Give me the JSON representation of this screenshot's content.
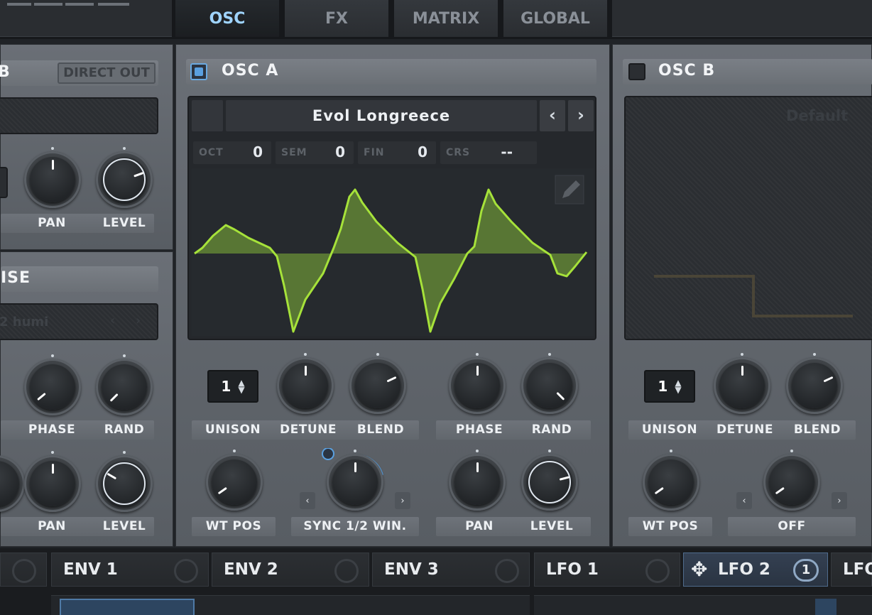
{
  "top_tabs": [
    {
      "label": "OSC",
      "active": true
    },
    {
      "label": "FX",
      "active": false
    },
    {
      "label": "MATRIX",
      "active": false
    },
    {
      "label": "GLOBAL",
      "active": false
    }
  ],
  "left_panel": {
    "header_partial": "B",
    "direct_out_label": "DIRECT OUT",
    "knob_row1_labels": [
      "PAN",
      "LEVEL"
    ],
    "noise_title_partial": "ISE",
    "noise_preset_partial": "2 humi",
    "knob_row2_labels": [
      "PHASE",
      "RAND"
    ],
    "knob_row3_labels": [
      "PAN",
      "LEVEL"
    ]
  },
  "osc_a": {
    "title": "OSC A",
    "enabled": true,
    "preset_name": "Evol Longreece",
    "pitch": [
      {
        "key": "OCT",
        "value": "0"
      },
      {
        "key": "SEM",
        "value": "0"
      },
      {
        "key": "FIN",
        "value": "0"
      },
      {
        "key": "CRS",
        "value": "--"
      }
    ],
    "unison_value": "1",
    "row1_labels": [
      "UNISON",
      "DETUNE",
      "BLEND"
    ],
    "row1b_labels": [
      "PHASE",
      "RAND"
    ],
    "row2_labels": [
      "WT POS",
      "SYNC 1/2 WIN."
    ],
    "row2b_labels": [
      "PAN",
      "LEVEL"
    ],
    "waveform_color": "#a6e23a"
  },
  "osc_b": {
    "title": "OSC B",
    "enabled": false,
    "preset_name": "Default",
    "unison_value": "1",
    "row1_labels": [
      "UNISON",
      "DETUNE",
      "BLEND"
    ],
    "row2_labels": [
      "WT POS",
      "OFF"
    ]
  },
  "modulators": [
    {
      "label": "ENV 1",
      "active": false
    },
    {
      "label": "ENV 2",
      "active": false
    },
    {
      "label": "ENV 3",
      "active": false
    },
    {
      "label": "LFO 1",
      "active": false
    },
    {
      "label": "LFO 2",
      "active": true,
      "badge": "1"
    },
    {
      "label": "LFO",
      "active": false
    }
  ],
  "colors": {
    "accent": "#5aa0e0",
    "waveform": "#a6e23a"
  },
  "icons": [
    "pencil-icon",
    "chevron-left-icon",
    "chevron-right-icon",
    "move-icon",
    "spin-arrows-icon"
  ]
}
